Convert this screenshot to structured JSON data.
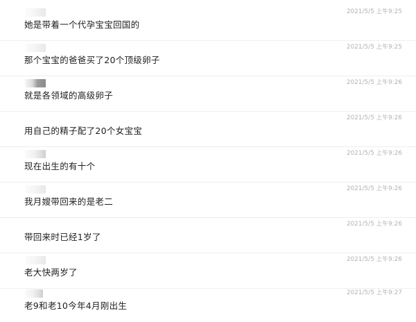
{
  "messages": [
    {
      "text": "她是带着一个代孕宝宝回国的",
      "time": "2021/5/5 上午9:25",
      "avatar_style": "light"
    },
    {
      "text": "那个宝宝的爸爸买了20个顶级卵子",
      "time": "2021/5/5 上午9:25",
      "avatar_style": "light"
    },
    {
      "text": "就是各领域的高级卵子",
      "time": "2021/5/5 上午9:26",
      "avatar_style": "dark"
    },
    {
      "text": "用自己的精子配了20个女宝宝",
      "time": "2021/5/5 上午9:26",
      "avatar_style": "none"
    },
    {
      "text": "现在出生的有十个",
      "time": "2021/5/5 上午9:26",
      "avatar_style": "normal"
    },
    {
      "text": "我月嫂带回来的是老二",
      "time": "2021/5/5 上午9:26",
      "avatar_style": "light"
    },
    {
      "text": "带回来时已经1岁了",
      "time": "2021/5/5 上午9:26",
      "avatar_style": "none"
    },
    {
      "text": "老大快两岁了",
      "time": "2021/5/5 上午9:26",
      "avatar_style": "light"
    },
    {
      "text": "老9和老10今年4月刚出生",
      "time": "2021/5/5 上午9:27",
      "avatar_style": "normal"
    }
  ]
}
